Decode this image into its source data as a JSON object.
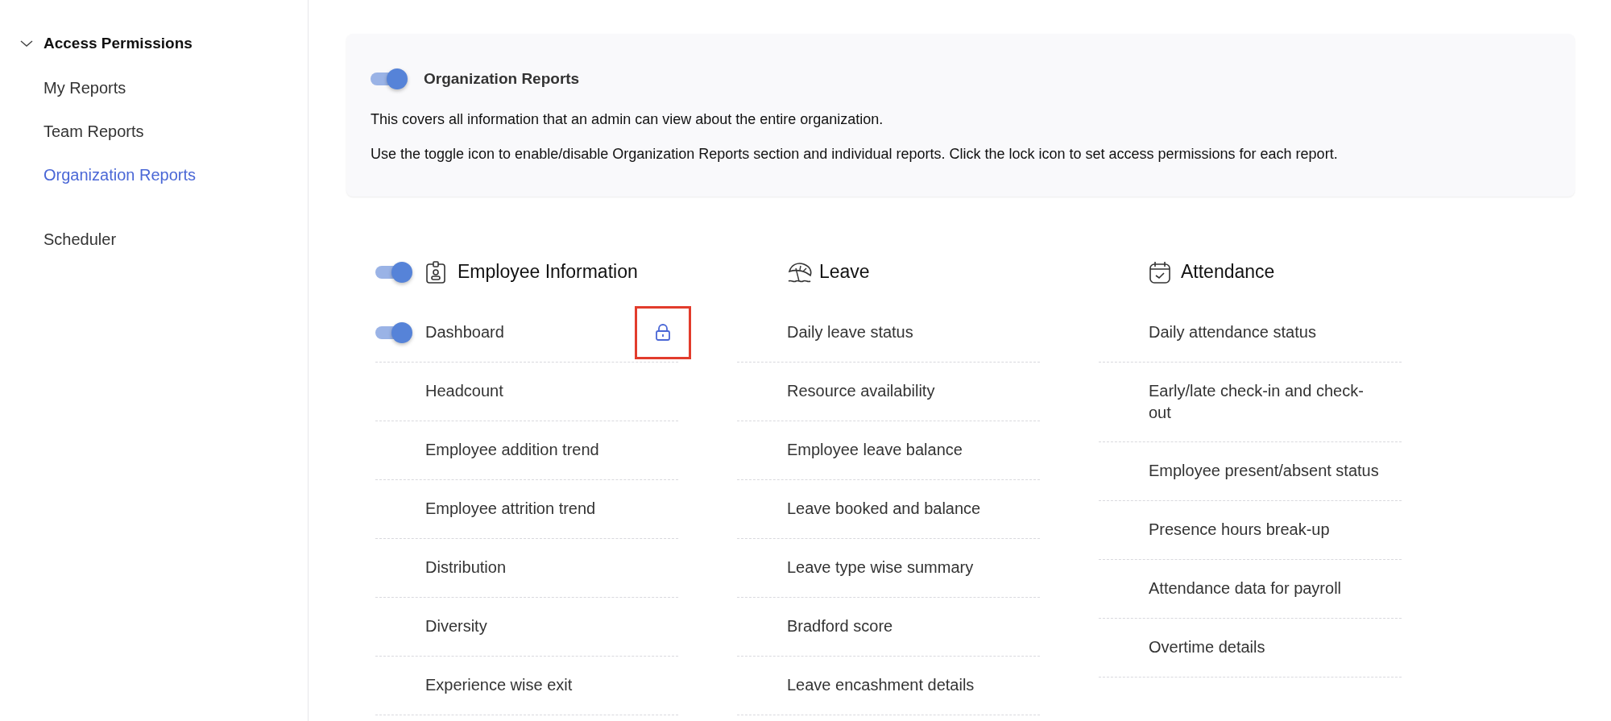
{
  "sidebar": {
    "group": {
      "label": "Access Permissions",
      "expanded": true
    },
    "items": [
      {
        "label": "My Reports",
        "selected": false
      },
      {
        "label": "Team Reports",
        "selected": false
      },
      {
        "label": "Organization Reports",
        "selected": true
      },
      {
        "label": "Scheduler",
        "selected": false
      }
    ]
  },
  "intro": {
    "toggle_on": true,
    "title": "Organization Reports",
    "lines": [
      "This covers all information that an admin can view about the entire organization.",
      "Use the toggle icon to enable/disable Organization Reports section and individual reports. Click the lock icon to set access permissions for each report."
    ]
  },
  "sections": [
    {
      "title": "Employee Information",
      "toggle_on": true,
      "items": [
        {
          "label": "Dashboard",
          "kind": "toggle",
          "on": true,
          "highlighted": true
        },
        {
          "label": "Headcount",
          "kind": "plain"
        },
        {
          "label": "Employee addition trend",
          "kind": "plain"
        },
        {
          "label": "Employee attrition trend",
          "kind": "plain"
        },
        {
          "label": "Distribution",
          "kind": "plain"
        },
        {
          "label": "Diversity",
          "kind": "plain"
        },
        {
          "label": "Experience wise exit",
          "kind": "plain"
        }
      ]
    },
    {
      "title": "Leave",
      "items": [
        {
          "label": "Daily leave status",
          "kind": "plain"
        },
        {
          "label": "Resource availability",
          "kind": "plain"
        },
        {
          "label": "Employee leave balance",
          "kind": "plain"
        },
        {
          "label": "Leave booked and balance",
          "kind": "plain"
        },
        {
          "label": "Leave type wise summary",
          "kind": "plain"
        },
        {
          "label": "Bradford score",
          "kind": "plain"
        },
        {
          "label": "Leave encashment details",
          "kind": "plain"
        }
      ]
    },
    {
      "title": "Attendance",
      "items": [
        {
          "label": "Daily attendance status",
          "kind": "plain"
        },
        {
          "label": "Early/late check-in and check-out",
          "kind": "plain"
        },
        {
          "label": "Employee present/absent status",
          "kind": "plain"
        },
        {
          "label": "Presence hours break-up",
          "kind": "plain"
        },
        {
          "label": "Attendance data for payroll",
          "kind": "plain"
        },
        {
          "label": "Overtime details",
          "kind": "plain"
        }
      ]
    }
  ]
}
